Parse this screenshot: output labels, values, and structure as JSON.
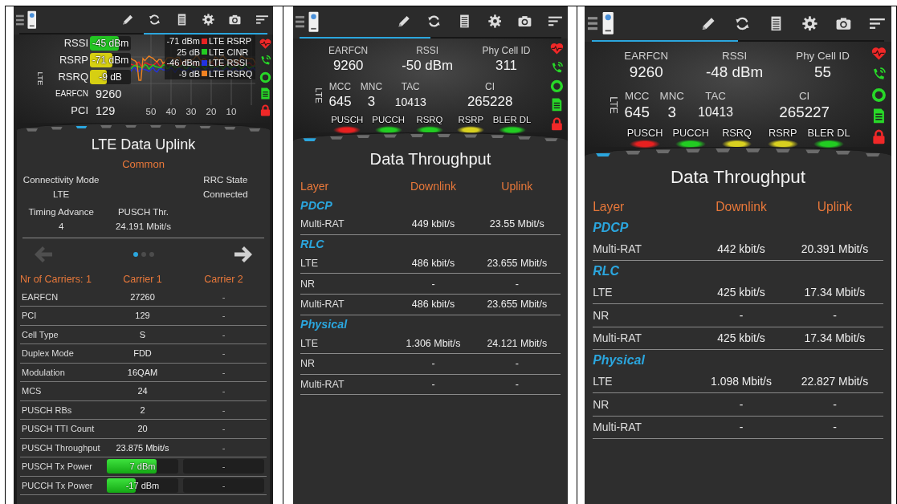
{
  "panels": [
    {
      "header_tabs": [
        {
          "selected": false
        },
        {
          "selected": true
        }
      ],
      "header": {
        "kind": "signal_chart",
        "rat": "LTE",
        "gauges": [
          {
            "label": "RSSI",
            "reading": "-45 dBm",
            "level": 0.7,
            "color": "#22c422"
          },
          {
            "label": "RSRP",
            "reading": "-71 dBm",
            "level": 0.55,
            "color": "#d6cf12"
          },
          {
            "label": "RSRQ",
            "reading": "-9 dB",
            "level": 0.42,
            "color": "#d6cf12"
          }
        ],
        "fields": [
          {
            "label": "EARFCN",
            "value": "9260"
          },
          {
            "label": "PCI",
            "value": "129"
          }
        ],
        "chart": {
          "x_labels": [
            "50",
            "40",
            "30",
            "20",
            "10"
          ],
          "legend": [
            {
              "reading": "-71 dBm",
              "label": "LTE RSRP",
              "color": "#e82222"
            },
            {
              "reading": "25 dB",
              "label": "LTE CINR",
              "color": "#22cc22"
            },
            {
              "reading": "-46 dBm",
              "label": "LTE RSSI",
              "color": "#2233e0"
            },
            {
              "reading": "-9 dB",
              "label": "LTE RSRQ",
              "color": "#f08222"
            }
          ]
        }
      },
      "status_icons": [
        {
          "kind": "heart",
          "color": "#f02828"
        },
        {
          "kind": "phone",
          "color": "#28d828"
        },
        {
          "kind": "ring",
          "color": "#28d828"
        },
        {
          "kind": "document",
          "color": "#28d828"
        },
        {
          "kind": "lock",
          "color": "#f02828"
        }
      ],
      "pages": [
        {
          "selected": false
        },
        {
          "selected": false
        },
        {
          "selected": true
        },
        {
          "selected": false
        },
        {
          "selected": false
        },
        {
          "selected": false
        },
        {
          "selected": false
        },
        {
          "selected": false
        },
        {
          "selected": false
        },
        {
          "selected": false
        }
      ],
      "content": {
        "kind": "uplink",
        "title": "LTE Data Uplink",
        "section": "Common",
        "fields": [
          {
            "label": "Connectivity Mode",
            "value": "LTE"
          },
          {
            "label": "RRC State",
            "value": "Connected"
          },
          {
            "label": "Timing Advance",
            "value": "4"
          },
          {
            "label": "PUSCH Thr.",
            "value": "24.191 Mbit/s"
          }
        ],
        "nav": {
          "back": {
            "disabled": true
          },
          "forward": {
            "disabled": false
          },
          "dots": [
            {
              "selected": true
            },
            {
              "selected": false
            },
            {
              "selected": false
            }
          ]
        },
        "carriers": {
          "columns": [
            "Nr of Carriers: 1",
            "Carrier 1",
            "Carrier 2"
          ],
          "rows": [
            {
              "kind": "text",
              "label": "EARFCN",
              "values": [
                "27260",
                "-"
              ]
            },
            {
              "kind": "text",
              "label": "PCI",
              "values": [
                "129",
                "-"
              ]
            },
            {
              "kind": "text",
              "label": "Cell Type",
              "values": [
                "S",
                "-"
              ]
            },
            {
              "kind": "text",
              "label": "Duplex Mode",
              "values": [
                "FDD",
                "-"
              ]
            },
            {
              "kind": "text",
              "label": "Modulation",
              "values": [
                "16QAM",
                "-"
              ]
            },
            {
              "kind": "text",
              "label": "MCS",
              "values": [
                "24",
                "-"
              ]
            },
            {
              "kind": "text",
              "label": "PUSCH RBs",
              "values": [
                "2",
                "-"
              ]
            },
            {
              "kind": "text",
              "label": "PUSCH TTI Count",
              "values": [
                "20",
                "-"
              ]
            },
            {
              "kind": "text",
              "label": "PUSCH Throughput",
              "values": [
                "23.875 Mbit/s",
                "-"
              ]
            },
            {
              "kind": "meter",
              "label": "PUSCH Tx Power",
              "meters": [
                {
                  "reading": "7 dBm",
                  "level": 0.7
                },
                {
                  "reading": "-"
                }
              ]
            },
            {
              "kind": "meter",
              "label": "PUCCH Tx Power",
              "meters": [
                {
                  "reading": "-17 dBm",
                  "level": 0.4
                },
                {
                  "reading": "-"
                }
              ]
            }
          ]
        }
      }
    },
    {
      "header_tabs": [
        {
          "selected": true
        },
        {
          "selected": false
        }
      ],
      "header": {
        "kind": "cell_info",
        "rat": "LTE",
        "top_fields": [
          {
            "label": "EARFCN",
            "value": "9260"
          },
          {
            "label": "RSSI",
            "value": "-50 dBm"
          },
          {
            "label": "Phy Cell ID",
            "value": "311"
          }
        ],
        "bottom_fields": [
          {
            "label": "MCC",
            "value": "645"
          },
          {
            "label": "MNC",
            "value": "3"
          },
          {
            "label": "TAC",
            "value": "10413"
          },
          {
            "label": "CI",
            "value": "265228"
          }
        ],
        "indicators": [
          {
            "label": "PUSCH",
            "color": "#e82020"
          },
          {
            "label": "PUCCH",
            "color": "#22cc22"
          },
          {
            "label": "RSRQ",
            "color": "#22cc22"
          },
          {
            "label": "RSRP",
            "color": "#d8d020"
          },
          {
            "label": "BLER DL",
            "color": "#22cc22"
          }
        ]
      },
      "status_icons": [
        {
          "kind": "heart",
          "color": "#f02828"
        },
        {
          "kind": "phone",
          "color": "#28d828"
        },
        {
          "kind": "ring",
          "color": "#28d828"
        },
        {
          "kind": "document",
          "color": "#28d828"
        },
        {
          "kind": "lock",
          "color": "#f02828"
        }
      ],
      "pages": [
        {
          "selected": true
        },
        {
          "selected": false
        },
        {
          "selected": false
        },
        {
          "selected": false
        },
        {
          "selected": false
        },
        {
          "selected": false
        },
        {
          "selected": false
        },
        {
          "selected": false
        },
        {
          "selected": false
        },
        {
          "selected": false
        }
      ],
      "content": {
        "kind": "throughput",
        "title": "Data Throughput",
        "columns": [
          "Layer",
          "Downlink",
          "Uplink"
        ],
        "groups": [
          {
            "name": "PDCP",
            "rows": [
              [
                "Multi-RAT",
                "449 kbit/s",
                "23.55 Mbit/s"
              ]
            ]
          },
          {
            "name": "RLC",
            "rows": [
              [
                "LTE",
                "486 kbit/s",
                "23.655 Mbit/s"
              ],
              [
                "NR",
                "-",
                "-"
              ],
              [
                "Multi-RAT",
                "486 kbit/s",
                "23.655 Mbit/s"
              ]
            ]
          },
          {
            "name": "Physical",
            "rows": [
              [
                "LTE",
                "1.306 Mbit/s",
                "24.121 Mbit/s"
              ],
              [
                "NR",
                "-",
                "-"
              ],
              [
                "Multi-RAT",
                "-",
                "-"
              ]
            ]
          }
        ]
      }
    },
    {
      "header_tabs": [
        {
          "selected": true
        },
        {
          "selected": false
        }
      ],
      "header": {
        "kind": "cell_info",
        "rat": "LTE",
        "top_fields": [
          {
            "label": "EARFCN",
            "value": "9260"
          },
          {
            "label": "RSSI",
            "value": "-48 dBm"
          },
          {
            "label": "Phy Cell ID",
            "value": "55"
          }
        ],
        "bottom_fields": [
          {
            "label": "MCC",
            "value": "645"
          },
          {
            "label": "MNC",
            "value": "3"
          },
          {
            "label": "TAC",
            "value": "10413"
          },
          {
            "label": "CI",
            "value": "265227"
          }
        ],
        "indicators": [
          {
            "label": "PUSCH",
            "color": "#e82020"
          },
          {
            "label": "PUCCH",
            "color": "#22cc22"
          },
          {
            "label": "RSRQ",
            "color": "#d8d020"
          },
          {
            "label": "RSRP",
            "color": "#d8d020"
          },
          {
            "label": "BLER DL",
            "color": "#22cc22"
          }
        ]
      },
      "status_icons": [
        {
          "kind": "heart",
          "color": "#f02828"
        },
        {
          "kind": "phone",
          "color": "#28d828"
        },
        {
          "kind": "ring",
          "color": "#28d828"
        },
        {
          "kind": "document",
          "color": "#28d828"
        },
        {
          "kind": "lock",
          "color": "#f02828"
        }
      ],
      "pages": [
        {
          "selected": true
        },
        {
          "selected": false
        },
        {
          "selected": false
        },
        {
          "selected": false
        },
        {
          "selected": false
        },
        {
          "selected": false
        },
        {
          "selected": false
        },
        {
          "selected": false
        },
        {
          "selected": false
        },
        {
          "selected": false
        }
      ],
      "content": {
        "kind": "throughput",
        "title": "Data Throughput",
        "columns": [
          "Layer",
          "Downlink",
          "Uplink"
        ],
        "groups": [
          {
            "name": "PDCP",
            "rows": [
              [
                "Multi-RAT",
                "442 kbit/s",
                "20.391 Mbit/s"
              ]
            ]
          },
          {
            "name": "RLC",
            "rows": [
              [
                "LTE",
                "425 kbit/s",
                "17.34 Mbit/s"
              ],
              [
                "NR",
                "-",
                "-"
              ],
              [
                "Multi-RAT",
                "425 kbit/s",
                "17.34 Mbit/s"
              ]
            ]
          },
          {
            "name": "Physical",
            "rows": [
              [
                "LTE",
                "1.098 Mbit/s",
                "22.827 Mbit/s"
              ],
              [
                "NR",
                "-",
                "-"
              ],
              [
                "Multi-RAT",
                "-",
                "-"
              ]
            ]
          }
        ]
      }
    }
  ]
}
